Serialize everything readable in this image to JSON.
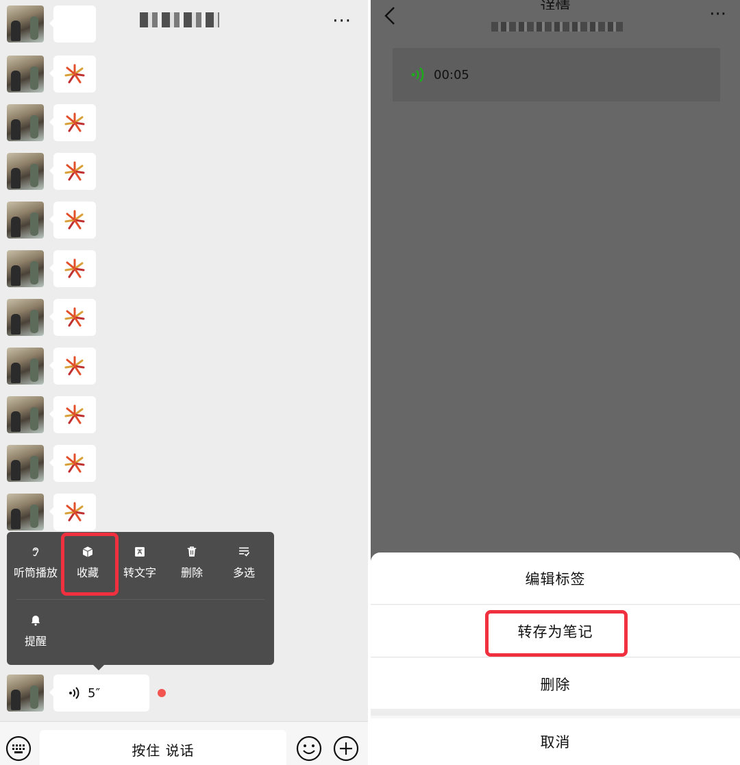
{
  "left": {
    "header": {
      "more_label": "···"
    },
    "popup_menu": {
      "items": [
        {
          "label": "听筒播放",
          "icon": "ear-icon"
        },
        {
          "label": "收藏",
          "icon": "cube-icon"
        },
        {
          "label": "转文字",
          "icon": "text-convert-icon"
        },
        {
          "label": "删除",
          "icon": "trash-icon"
        },
        {
          "label": "多选",
          "icon": "multi-select-icon"
        },
        {
          "label": "提醒",
          "icon": "bell-icon"
        }
      ]
    },
    "voice_message": {
      "duration": "5″"
    },
    "input_bar": {
      "hold_to_talk": "按住 说话"
    }
  },
  "right": {
    "header": {
      "title": "详情",
      "more_label": "···"
    },
    "voice_card": {
      "time": "00:05"
    },
    "action_sheet": {
      "items": [
        "编辑标签",
        "转存为笔记",
        "删除"
      ],
      "cancel": "取消"
    }
  },
  "colors": {
    "highlight": "#f02f3f",
    "voice_green": "#1aad19",
    "unread": "#f25550"
  }
}
